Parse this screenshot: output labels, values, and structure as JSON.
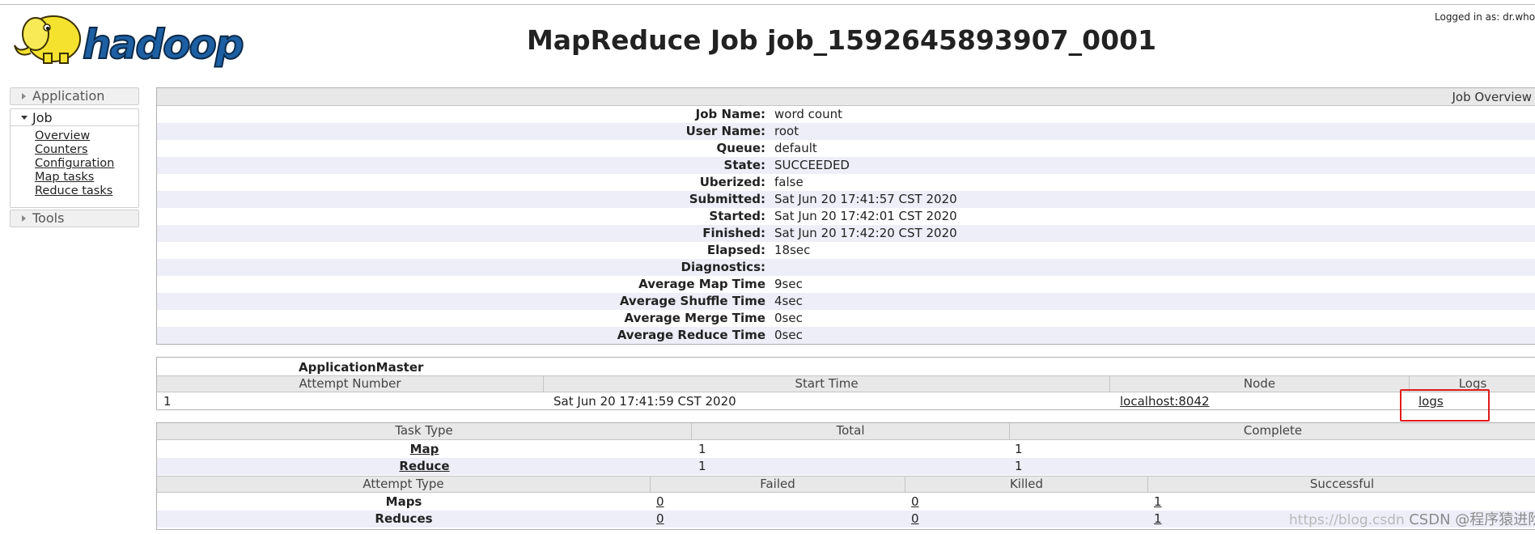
{
  "header": {
    "logo_text": "hadoop",
    "title": "MapReduce Job job_1592645893907_0001",
    "logged_in": "Logged in as: dr.who"
  },
  "sidebar": {
    "application_label": "Application",
    "job_label": "Job",
    "job_links": [
      "Overview",
      "Counters",
      "Configuration",
      "Map tasks",
      "Reduce tasks"
    ],
    "tools_label": "Tools"
  },
  "overview": {
    "heading": "Job Overview",
    "rows": [
      {
        "label": "Job Name:",
        "value": "word count"
      },
      {
        "label": "User Name:",
        "value": "root"
      },
      {
        "label": "Queue:",
        "value": "default"
      },
      {
        "label": "State:",
        "value": "SUCCEEDED"
      },
      {
        "label": "Uberized:",
        "value": "false"
      },
      {
        "label": "Submitted:",
        "value": "Sat Jun 20 17:41:57 CST 2020"
      },
      {
        "label": "Started:",
        "value": "Sat Jun 20 17:42:01 CST 2020"
      },
      {
        "label": "Finished:",
        "value": "Sat Jun 20 17:42:20 CST 2020"
      },
      {
        "label": "Elapsed:",
        "value": "18sec"
      },
      {
        "label": "Diagnostics:",
        "value": ""
      },
      {
        "label": "Average Map Time",
        "value": "9sec"
      },
      {
        "label": "Average Shuffle Time",
        "value": "4sec"
      },
      {
        "label": "Average Merge Time",
        "value": "0sec"
      },
      {
        "label": "Average Reduce Time",
        "value": "0sec"
      }
    ]
  },
  "app_master": {
    "title": "ApplicationMaster",
    "headers": [
      "Attempt Number",
      "Start Time",
      "Node",
      "Logs"
    ],
    "row": {
      "attempt": "1",
      "start_time": "Sat Jun 20 17:41:59 CST 2020",
      "node": "localhost:8042",
      "logs": "logs"
    }
  },
  "tasks": {
    "headers": [
      "Task Type",
      "Total",
      "Complete"
    ],
    "rows": [
      {
        "type": "Map",
        "total": "1",
        "complete": "1"
      },
      {
        "type": "Reduce",
        "total": "1",
        "complete": "1"
      }
    ],
    "attempt_headers": [
      "Attempt Type",
      "Failed",
      "Killed",
      "Successful"
    ],
    "attempt_rows": [
      {
        "type": "Maps",
        "failed": "0",
        "killed": "0",
        "successful": "1"
      },
      {
        "type": "Reduces",
        "failed": "0",
        "killed": "0",
        "successful": "1"
      }
    ]
  },
  "watermark": {
    "url_text": "https://blog.csdn",
    "brand_text": "CSDN @程序猿进阶"
  },
  "colors": {
    "highlight": "#e01b1b",
    "header_bg": "#e8e8e8",
    "stripe_bg": "#eeeef9",
    "logo_yellow": "#f5e22e",
    "logo_blue": "#1d5fa3"
  }
}
